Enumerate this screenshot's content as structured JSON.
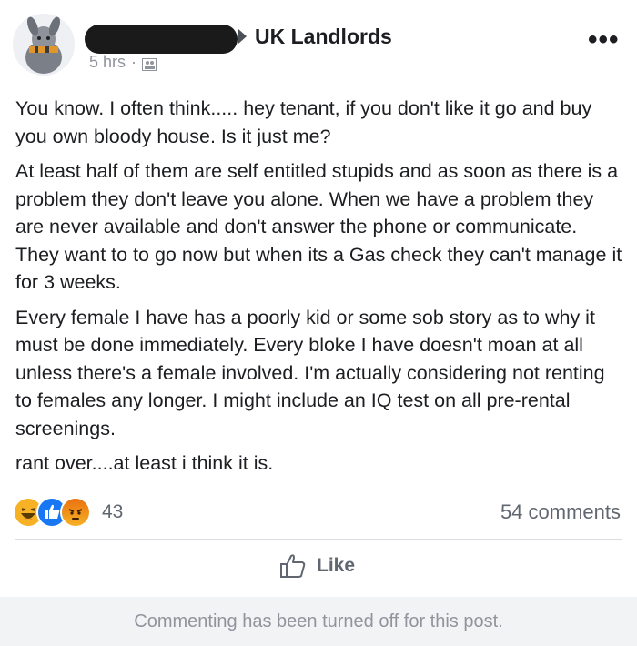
{
  "post": {
    "group_name": "UK Landlords",
    "timestamp": "5 hrs",
    "separator": "·",
    "paragraphs": [
      "You know. I often think..... hey tenant, if you don't like it go and buy you own bloody house. Is it just me?",
      "At least half of them are self entitled stupids and as soon as there is a problem they don't leave you alone. When we have a problem they are never available and don't answer the phone or communicate. They want to to go now but when its a Gas check they can't manage it for 3 weeks.",
      "Every female I have has a poorly kid or some sob story as to why it must be done immediately. Every bloke I have doesn't moan at all unless there's a female involved. I'm actually considering not renting to females any longer. I might include an IQ test on all pre-rental screenings.",
      "rant over....at least i think it is."
    ]
  },
  "reactions": {
    "icons": [
      "haha-icon",
      "like-reaction-icon",
      "angry-icon"
    ],
    "count": "43",
    "comments": "54 comments"
  },
  "actions": {
    "like_label": "Like"
  },
  "footer": {
    "notice": "Commenting has been turned off for this post."
  },
  "colors": {
    "text": "#1c1e21",
    "muted": "#606770",
    "like_blue": "#1877f2",
    "haha_yellow": "#f7b125",
    "angry_orange": "#e9710f",
    "footer_bg": "#f2f3f5"
  }
}
